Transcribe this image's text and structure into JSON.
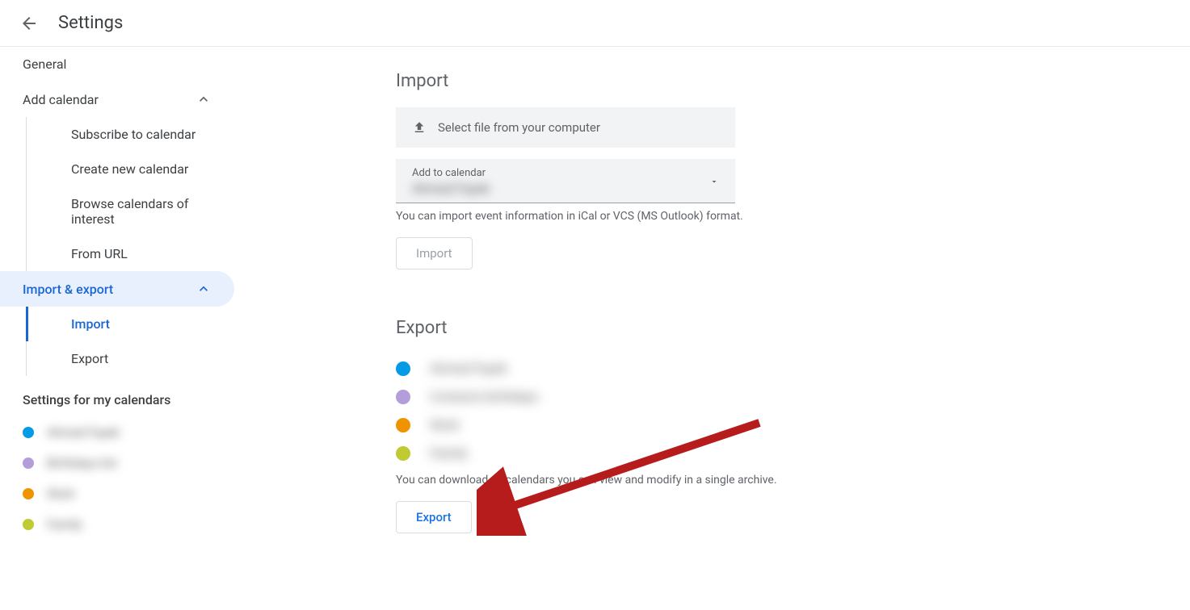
{
  "header": {
    "title": "Settings"
  },
  "sidebar": {
    "general": "General",
    "add_calendar": "Add calendar",
    "add_calendar_items": {
      "subscribe": "Subscribe to calendar",
      "create_new": "Create new calendar",
      "browse": "Browse calendars of interest",
      "from_url": "From URL"
    },
    "import_export": "Import & export",
    "import_export_items": {
      "import": "Import",
      "export": "Export"
    },
    "settings_for_calendars": "Settings for my calendars",
    "my_calendars": [
      {
        "color": "#039be5",
        "name": "Ahmed Fayek"
      },
      {
        "color": "#b39ddb",
        "name": "Birthdays list"
      },
      {
        "color": "#f09300",
        "name": "Work"
      },
      {
        "color": "#c0ca33",
        "name": "Family"
      }
    ]
  },
  "import_section": {
    "title": "Import",
    "select_file": "Select file from your computer",
    "add_to_calendar_label": "Add to calendar",
    "add_to_calendar_value": "Ahmed Fayek",
    "helper": "You can import event information in iCal or VCS (MS Outlook) format.",
    "button": "Import"
  },
  "export_section": {
    "title": "Export",
    "calendars": [
      {
        "color": "#039be5",
        "name": "Ahmed Fayek"
      },
      {
        "color": "#b39ddb",
        "name": "Contacts birthdays"
      },
      {
        "color": "#f09300",
        "name": "Work"
      },
      {
        "color": "#c0ca33",
        "name": "Family"
      }
    ],
    "helper": "You can download all calendars you can view and modify in a single archive.",
    "button": "Export"
  }
}
